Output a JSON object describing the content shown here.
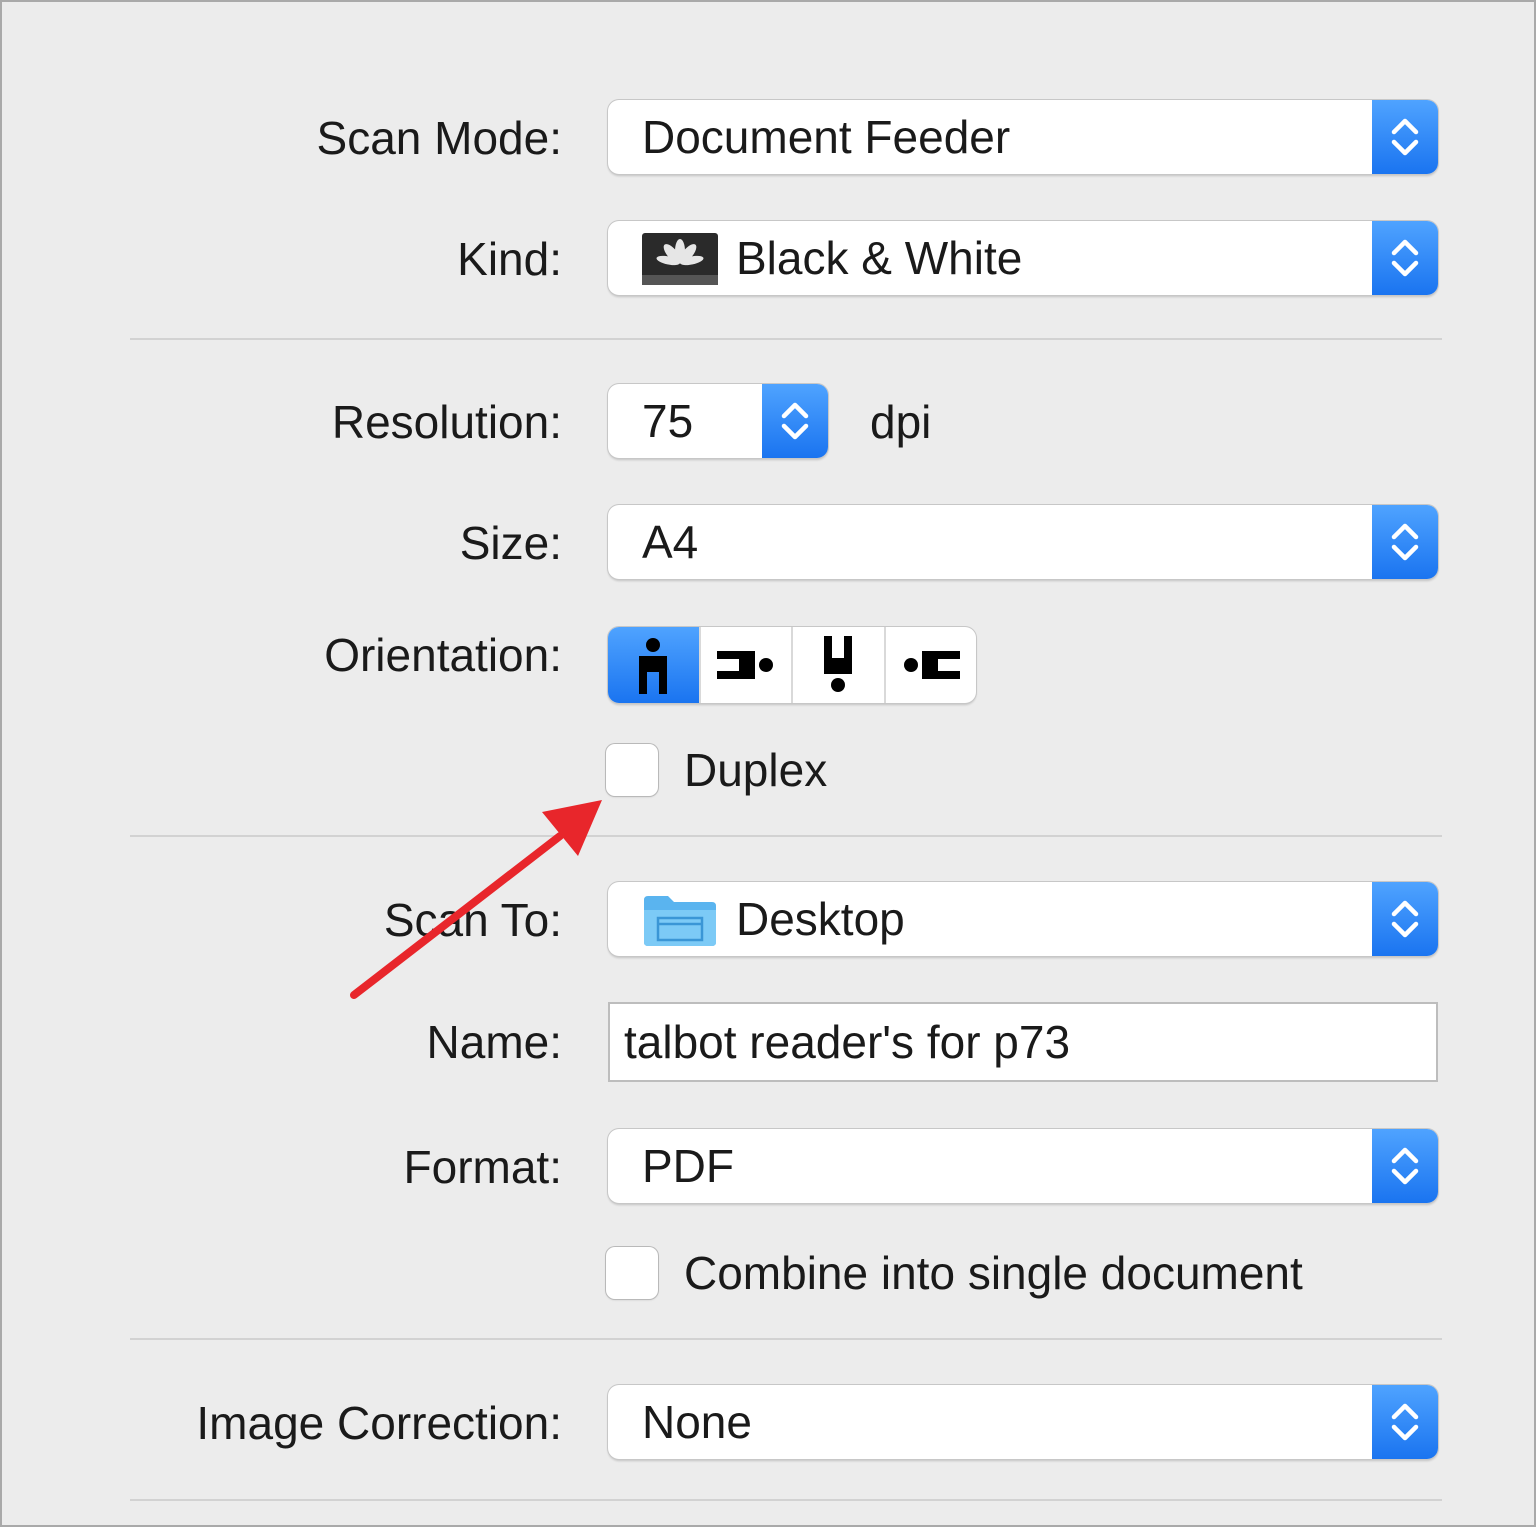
{
  "scan_mode": {
    "label": "Scan Mode:",
    "value": "Document Feeder"
  },
  "kind": {
    "label": "Kind:",
    "value": "Black & White",
    "icon": "flower-bw-thumbnail-icon"
  },
  "resolution": {
    "label": "Resolution:",
    "value": "75",
    "unit": "dpi"
  },
  "size": {
    "label": "Size:",
    "value": "A4"
  },
  "orientation": {
    "label": "Orientation:",
    "options": [
      "portrait-upright",
      "rotated-left",
      "upside-down",
      "rotated-right"
    ],
    "selected": "portrait-upright"
  },
  "duplex": {
    "label": "Duplex",
    "checked": false
  },
  "scan_to": {
    "label": "Scan To:",
    "value": "Desktop",
    "icon": "folder-icon"
  },
  "name": {
    "label": "Name:",
    "value": "talbot reader's for p73"
  },
  "format": {
    "label": "Format:",
    "value": "PDF"
  },
  "combine": {
    "label": "Combine into single document",
    "checked": false
  },
  "image_correction": {
    "label": "Image Correction:",
    "value": "None"
  },
  "colors": {
    "accent": "#1a74f0",
    "annotation_arrow": "#e8262b",
    "background": "#ececec"
  }
}
